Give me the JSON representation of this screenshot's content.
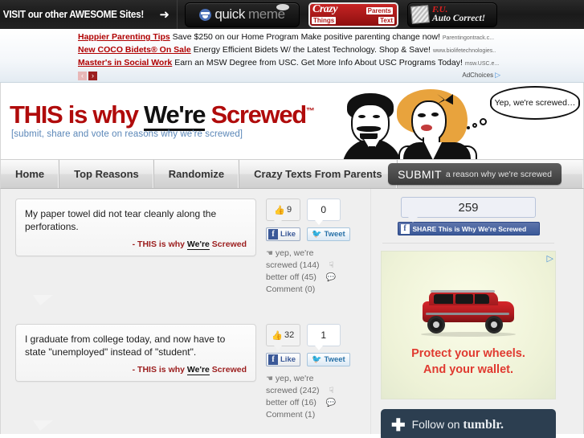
{
  "topbar": {
    "visit_label": "VISIT our other AWESOME Sites!",
    "arrow": "➜",
    "sites": [
      {
        "name": "quickmeme",
        "part1": "quick",
        "part2": "meme"
      },
      {
        "name": "crazy-things-parents-text",
        "crazy": "Crazy",
        "things": "Things",
        "parents": "Parents",
        "text": "Text"
      },
      {
        "name": "fu-auto-correct",
        "fu": "F.U.",
        "auto": "Auto Correct!"
      }
    ]
  },
  "ads": {
    "rows": [
      {
        "title": "Happier Parenting Tips",
        "desc": "Save $250 on our Home Program Make positive parenting change now!",
        "url": "Parentingontrack.c..."
      },
      {
        "title": "New COCO Bidets® On Sale",
        "desc": "Energy Efficient Bidets W/ the Latest Technology. Shop & Save!",
        "url": "www.biolifetechnologies.."
      },
      {
        "title": "Master's in Social Work",
        "desc": "Earn an MSW Degree from USC. Get More Info About USC Programs Today!",
        "url": "msw.USC.e..."
      }
    ],
    "prev": "‹",
    "next": "›",
    "adchoices": "AdChoices"
  },
  "masthead": {
    "logo": {
      "this": "THIS",
      "is_why": "is why",
      "were": "We're",
      "screwed": "Screwed",
      "tm": "™"
    },
    "tagline": "[submit, share and vote on reasons why we're screwed]",
    "bubble": "Yep, we're screwed…"
  },
  "nav": {
    "items": [
      {
        "label": "Home",
        "name": "home"
      },
      {
        "label": "Top Reasons",
        "name": "top-reasons"
      },
      {
        "label": "Randomize",
        "name": "randomize"
      },
      {
        "label": "Crazy Texts From Parents",
        "name": "crazy-texts-from-parents"
      }
    ],
    "submit_strong": "SUBMIT",
    "submit_sub": "a reason why we're screwed"
  },
  "posts": [
    {
      "text": "My paper towel did not tear cleanly along the perforations.",
      "attr_prefix": "- THIS is why ",
      "attr_were": "We're",
      "attr_screwed": " Screwed",
      "fb_count": "9",
      "tweet_count": "0",
      "like_label": "Like",
      "tweet_label": "Tweet",
      "yep_label": "yep, we're screwed",
      "yep_count": "(144)",
      "better_label": "better off",
      "better_count": "(45)",
      "comment_label": "Comment",
      "comment_count": "(0)"
    },
    {
      "text": "I graduate from college today, and now have to state \"unemployed\" instead of \"student\".",
      "attr_prefix": "- THIS is why ",
      "attr_were": "We're",
      "attr_screwed": " Screwed",
      "fb_count": "32",
      "tweet_count": "1",
      "like_label": "Like",
      "tweet_label": "Tweet",
      "yep_label": "yep, we're screwed",
      "yep_count": "(242)",
      "better_label": "better off",
      "better_count": "(16)",
      "comment_label": "Comment",
      "comment_count": "(1)"
    }
  ],
  "sidebar": {
    "share_count": "259",
    "share_label": "SHARE This is Why We're Screwed",
    "ad": {
      "line1": "Protect your wheels.",
      "line2": "And your wallet.",
      "adchoices_glyph": "▷"
    },
    "tumblr": {
      "plus": "✚",
      "prefix": "Follow on ",
      "brand": "tumblr."
    }
  },
  "colors": {
    "brand_red": "#b00b0b",
    "facebook_blue": "#3b5998",
    "twitter_blue": "#56a7dc",
    "ad_red": "#e03a30",
    "tumblr_navy": "#2c3e50"
  }
}
